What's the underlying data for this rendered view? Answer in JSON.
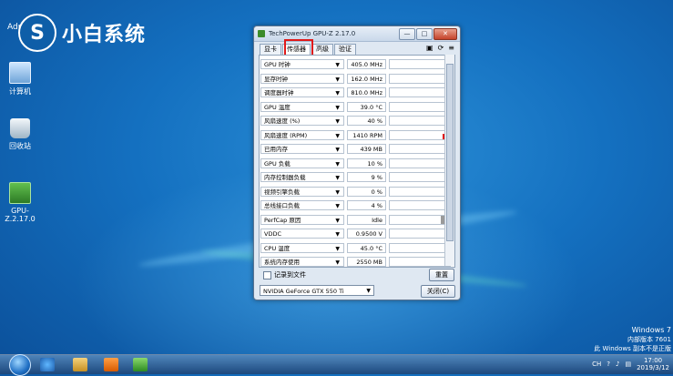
{
  "colors": {
    "accent": "#e01a1a",
    "titlebar": "#c9d8ea",
    "desktop": "#1470c0"
  },
  "logo": {
    "mark": "S",
    "text": "小白系统",
    "user_label": "Adm"
  },
  "desktop_icons": [
    {
      "label": "计算机",
      "icon": "computer-icon"
    },
    {
      "label": "回收站",
      "icon": "recycle-bin-icon"
    },
    {
      "label": "GPU-Z.2.17.0",
      "icon": "gpu-z-icon"
    }
  ],
  "window": {
    "title": "TechPowerUp GPU-Z 2.17.0",
    "buttons": {
      "minimize": "—",
      "maximize": "□",
      "close": "✕"
    },
    "tabs": [
      "显卡",
      "传感器",
      "高级",
      "验证"
    ],
    "active_tab": 1,
    "tool_icons": [
      "camera-icon",
      "refresh-icon",
      "menu-icon"
    ],
    "tool_glyphs": [
      "▣",
      "⟳",
      "≡"
    ],
    "sensors": [
      {
        "name": "GPU 时钟",
        "value": "405.0 MHz",
        "graph": 0.2
      },
      {
        "name": "显存时钟",
        "value": "162.0 MHz",
        "graph": 0.15
      },
      {
        "name": "调度器时钟",
        "value": "810.0 MHz",
        "graph": 0.3
      },
      {
        "name": "GPU 温度",
        "value": "39.0 °C",
        "graph": 0.25
      },
      {
        "name": "风扇速度 (%)",
        "value": "40 %",
        "graph": 0.4
      },
      {
        "name": "风扇速度 (RPM)",
        "value": "1410 RPM",
        "graph": 0.55
      },
      {
        "name": "已用内存",
        "value": "439 MB",
        "graph": 0.3
      },
      {
        "name": "GPU 负载",
        "value": "10 %",
        "graph": 0.1
      },
      {
        "name": "内存控制器负载",
        "value": "9 %",
        "graph": 0.08
      },
      {
        "name": "视频引擎负载",
        "value": "0 %",
        "graph": 0.0
      },
      {
        "name": "总线接口负载",
        "value": "4 %",
        "graph": 0.05
      },
      {
        "name": "PerfCap 原因",
        "value": "Idle",
        "graph": 1.0
      },
      {
        "name": "VDDC",
        "value": "0.9500 V",
        "graph": 0.35
      },
      {
        "name": "CPU 温度",
        "value": "45.0 °C",
        "graph": 0.3
      },
      {
        "name": "系统内存使用",
        "value": "2550 MB",
        "graph": 0.2
      }
    ],
    "log_label": "记录到文件",
    "reset_label": "重置",
    "gpu_select": "NVIDIA GeForce GTX 550 Ti",
    "close_label": "关闭(C)"
  },
  "watermark": {
    "line1": "Windows 7",
    "line2": "内部版本 7601",
    "line3": "此 Windows 副本不是正版"
  },
  "taskbar": {
    "tray_text": "CH",
    "clock_time": "17:00",
    "clock_date": "2019/3/12"
  }
}
